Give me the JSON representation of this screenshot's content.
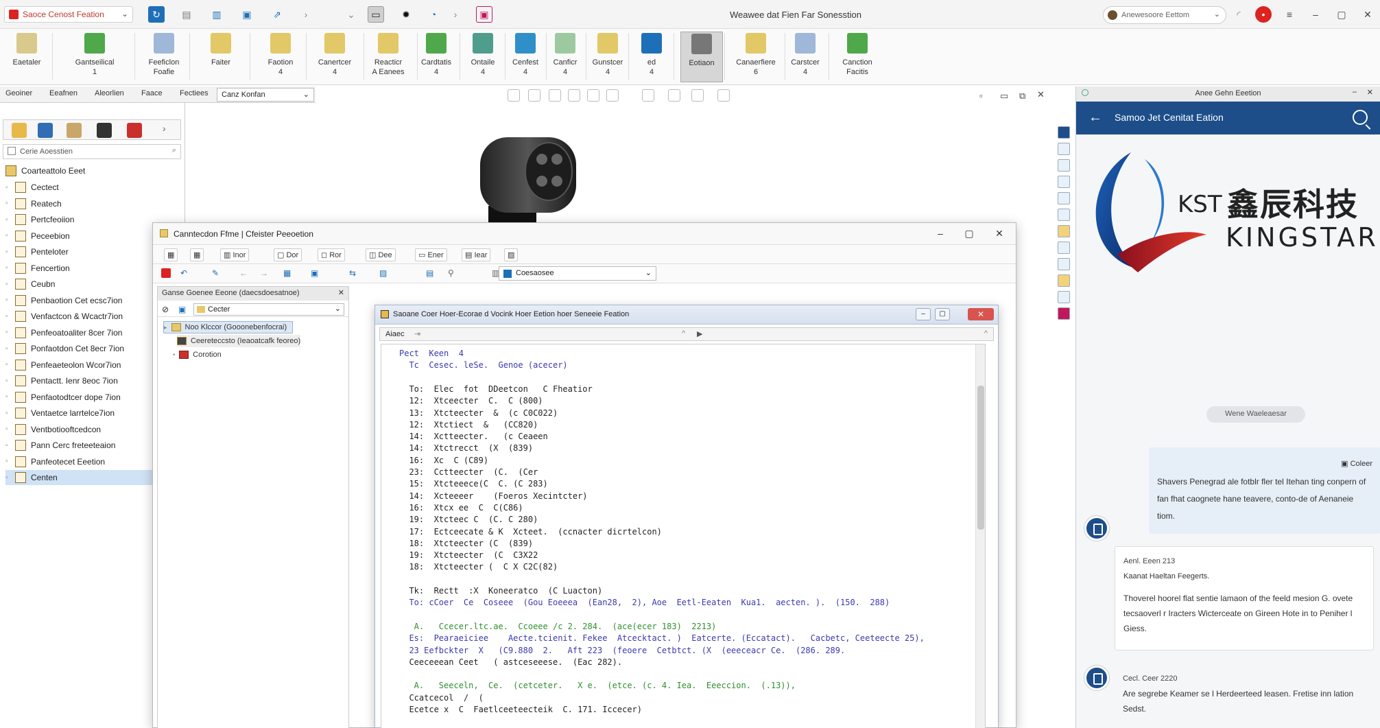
{
  "app": {
    "dropdown_label": "Saoce Cenost Feation",
    "window_title": "Weawee dat Fien Far Sonesstion",
    "search_placeholder": "Anewesoore Eettom"
  },
  "ribbon": {
    "items": [
      {
        "label": "Eaetaler",
        "sub": ""
      },
      {
        "label": "Gantseilical",
        "sub": "1"
      },
      {
        "label": "Feeficlon",
        "sub": "Foafie"
      },
      {
        "label": "Faiter",
        "sub": ""
      },
      {
        "label": "Faotion",
        "sub": "4"
      },
      {
        "label": "Canertcer",
        "sub": "4"
      },
      {
        "label": "Reacticr",
        "sub": "A Eanees"
      },
      {
        "label": "Cardtatis",
        "sub": "4"
      },
      {
        "label": "Ontaile",
        "sub": "4"
      },
      {
        "label": "Cenfest",
        "sub": "4"
      },
      {
        "label": "Canficr",
        "sub": "4"
      },
      {
        "label": "Gunstcer",
        "sub": "4"
      },
      {
        "label": "ed",
        "sub": "4"
      },
      {
        "label": "",
        "sub": "Eotiaon"
      },
      {
        "label": "Canaerfiere",
        "sub": "6"
      },
      {
        "label": "Carstcer",
        "sub": "4"
      },
      {
        "label": "Canction",
        "sub": "Facitis"
      }
    ]
  },
  "tabs": {
    "items": [
      "Geoiner",
      "Eeafnen",
      "Aleorlien",
      "Faace",
      "Fectiees"
    ],
    "dropdown": "Canz Konfan"
  },
  "left_panel": {
    "search_placeholder": "Cerie Aoesstien",
    "root": "Coarteattolo Eeet",
    "items": [
      "Cectect",
      "Reatech",
      "Pertcfeoiion",
      "Peceebion",
      "Penteloter",
      "Fencertion",
      "Ceubn",
      "Penbaotion Cet ecsc7ion",
      "Venfactcon &  Wcactr7ion",
      "Penfeoatoaliter 8cer 7ion",
      "Ponfaotdon Cet 8ecr 7ion",
      "Penfeaeteolon Wcor7ion",
      "Pentactt. Ienr 8eoc 7ion",
      "Penfaotodtcer dope 7ion",
      "Ventaetce larrtelce7ion",
      "Ventbotiooftcedcon",
      "Pann Cerc freteeteaion",
      "Panfeotecet Eeetion",
      "Centen"
    ]
  },
  "win1": {
    "title": "Canntecdon Ffme | Cfeister Peeoetion",
    "toolbar1": [
      "Inor",
      "Dor",
      "Ror",
      "Dee",
      "Ener",
      "Iear"
    ],
    "toolbar2_dd": "Coesaosee",
    "left_head": "Ganse Goenee Eeone (daecsdoesatnoe)",
    "left_combo": "Cecter",
    "tree": [
      "Noo Klccor (Gooonebenfocrai)",
      "Ceereteccsto (Ieaoatcafk feoreo)",
      "Corotion"
    ]
  },
  "win2": {
    "title": "Saoane Coer Hoer-Ecorae d Vocink Hoer Eetion hoer Seneeie Feation",
    "bar_label": "Aiaec",
    "code": [
      {
        "t": "Pect  Keen  4",
        "c": "blue"
      },
      {
        "t": "  Tc  Cesec. leSe.  Genoe (acecer)",
        "c": "blue"
      },
      {
        "t": "",
        "c": ""
      },
      {
        "t": "  To:  Elec  fot  DDeetcon   C Fheatior",
        "c": ""
      },
      {
        "t": "  12:  Xtceecter  C.  C (800)",
        "c": ""
      },
      {
        "t": "  13:  Xtcteecter  &  (c C0C022)",
        "c": ""
      },
      {
        "t": "  12:  Xtctiect  &   (CC820)",
        "c": ""
      },
      {
        "t": "  14:  Xctteecter.   (c Ceaeen",
        "c": ""
      },
      {
        "t": "  14:  Xtctrecct  (X  (839)",
        "c": ""
      },
      {
        "t": "  16:  Xc  C (C89)",
        "c": ""
      },
      {
        "t": "  23:  Cctteecter  (C.  (Cer",
        "c": ""
      },
      {
        "t": "  15:  Xtcteeece(C  C. (C 283)",
        "c": ""
      },
      {
        "t": "  14:  Xcteeeer    (Foeros Xecintcter)",
        "c": ""
      },
      {
        "t": "  16:  Xtcx ee  C  C(C86)",
        "c": ""
      },
      {
        "t": "  19:  Xtcteec C  (C. C 280)",
        "c": ""
      },
      {
        "t": "  17:  Ectceecate & K  Xcteet.  (ccnacter dicrtelcon)",
        "c": ""
      },
      {
        "t": "  18:  Xtcteecter (C  (839)",
        "c": ""
      },
      {
        "t": "  19:  Xtcteecter  (C  C3X22",
        "c": ""
      },
      {
        "t": "  18:  Xtcteecter (  C X C2C(82)",
        "c": ""
      },
      {
        "t": "",
        "c": ""
      },
      {
        "t": "  Tk:  Rectt  :X  Koneeratco  (C Luacton)",
        "c": ""
      },
      {
        "t": "  To: cCoer  Ce  Coseee  (Gou Eoeeea  (Ean28,  2), Aoe  Eetl-Eeaten  Kua1.  aecten. ).  (150.  288)",
        "c": "blue"
      },
      {
        "t": "",
        "c": ""
      },
      {
        "t": "   A.   Ccecer.ltc.ae.  Ccoeee /c 2. 284.  (ace(ecer 183)  2213)",
        "c": "green"
      },
      {
        "t": "  Es:  Pearaeiciee    Aecte.tcienit. Fekee  Atcecktact. )  Eatcerte. (Eccatact).   Cacbetc, Ceeteecte 25),",
        "c": "blue"
      },
      {
        "t": "  23 Eefbckter  X   (C9.880  2.   Aft 223  (feoere  Cetbtct. (X  (eeeceacr Ce.  (286. 289.",
        "c": "blue"
      },
      {
        "t": "  Ceeceeean Ceet   ( astceseeese.  (Eac 282).",
        "c": ""
      },
      {
        "t": "",
        "c": ""
      },
      {
        "t": "   A.   Seeceln,  Ce.  (cetceter.   X e.  (etce. (c. 4. Iea.  Eeeccion.  (.13)),",
        "c": "green"
      },
      {
        "t": "  Ccatcecol  /  (",
        "c": ""
      },
      {
        "t": "  Ecetce x  C  Faetlceeteecteik  C. 171. Iccecer)",
        "c": ""
      }
    ]
  },
  "right_panel": {
    "header": "Anee Gehn Eeetion",
    "nav_title": "Samoo Jet Cenitat Eation",
    "logo_kst": "KST",
    "logo_cn": "鑫辰科技",
    "logo_en": "KINGSTAR",
    "chip": "Wene Waeleaesar",
    "bubble_head": "Coleer",
    "bubble_text": "Shavers Penegrad ale fotblr fler tel Itehan ting conpern of fan fhat caognete hane teavere, conto-de of Aenaneie tiom.",
    "msg1_head": "Aenl.  Eeen 213",
    "msg1_sub": "Kaanat Haeltan Feegerts.",
    "msg1_body": "Thoverel hoorel flat sentie lamaon of the feeld mesion G. ovete tecsaoverl r Iracters Wicterceate on Gireen Hote in to Peniher l Giess.",
    "msg2_head": "Cecl.  Ceer 2220",
    "msg2_body": "Are segrebe Keamer se l Herdeerteed leasen. Fretise inn lation Sedst."
  },
  "colors": {
    "nav_blue": "#1d4e8a",
    "accent_red": "#d22222",
    "selection": "#cfe2f6"
  }
}
